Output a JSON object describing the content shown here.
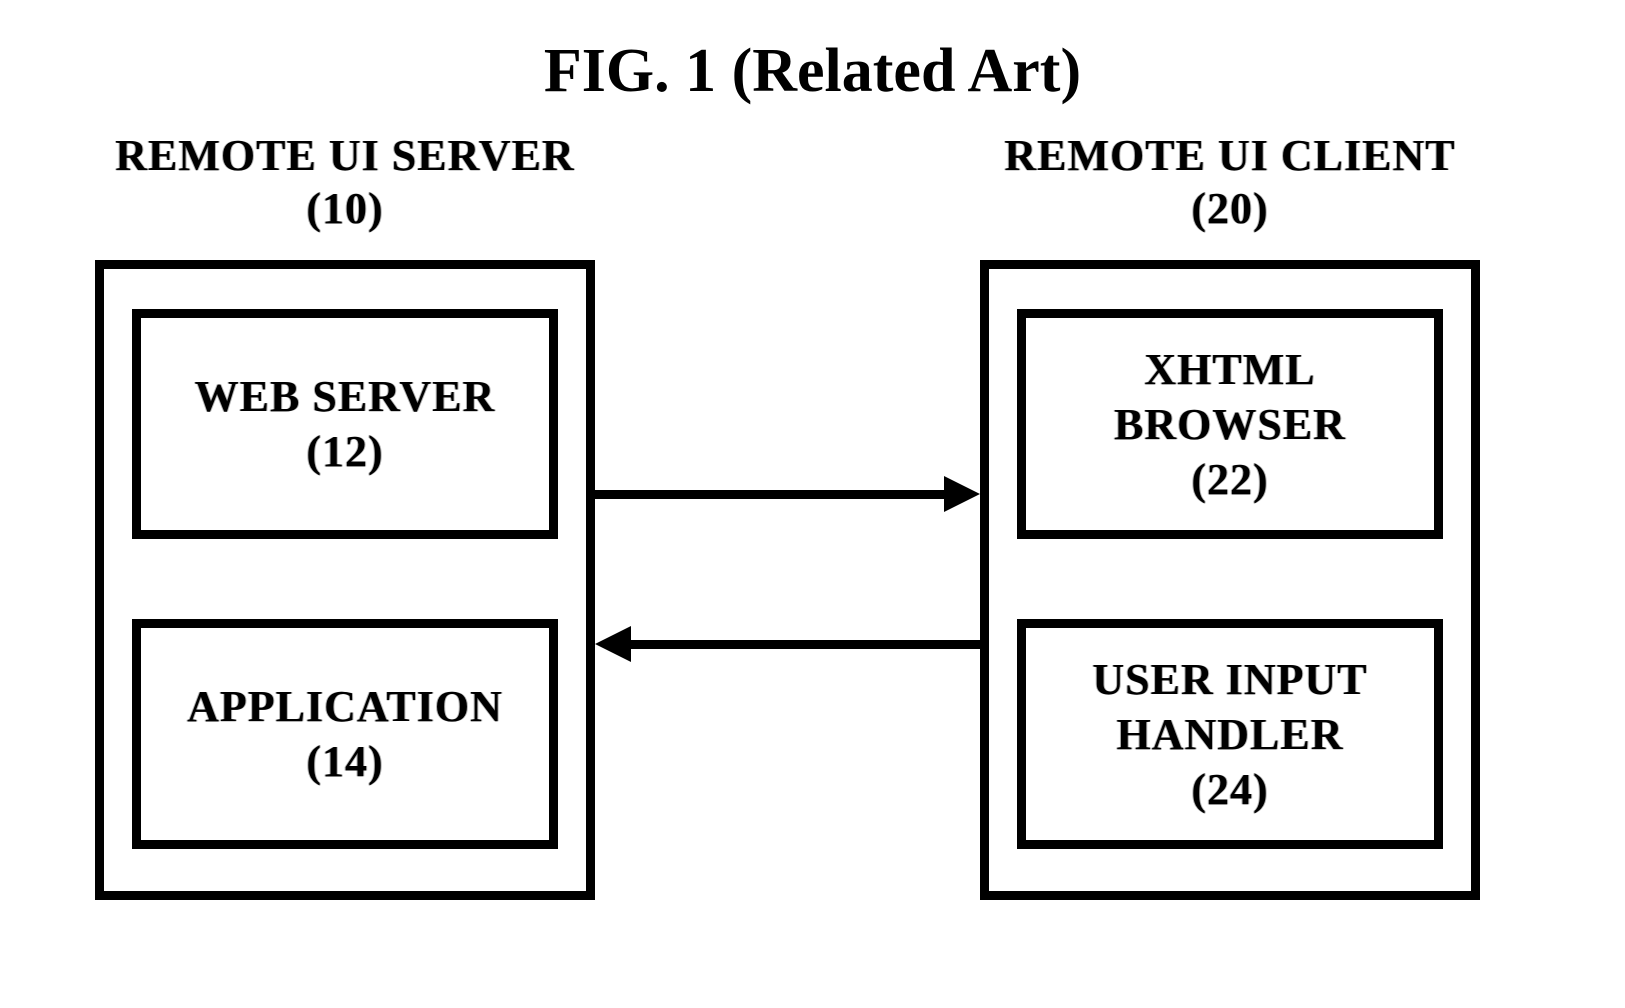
{
  "title": "FIG. 1 (Related Art)",
  "server": {
    "label_line1": "REMOTE UI SERVER",
    "label_line2": "(10)",
    "webserver_line1": "WEB SERVER",
    "webserver_line2": "(12)",
    "application_line1": "APPLICATION",
    "application_line2": "(14)"
  },
  "client": {
    "label_line1": "REMOTE UI CLIENT",
    "label_line2": "(20)",
    "browser_line1": "XHTML",
    "browser_line2": "BROWSER",
    "browser_line3": "(22)",
    "handler_line1": "USER INPUT",
    "handler_line2": "HANDLER",
    "handler_line3": "(24)"
  }
}
